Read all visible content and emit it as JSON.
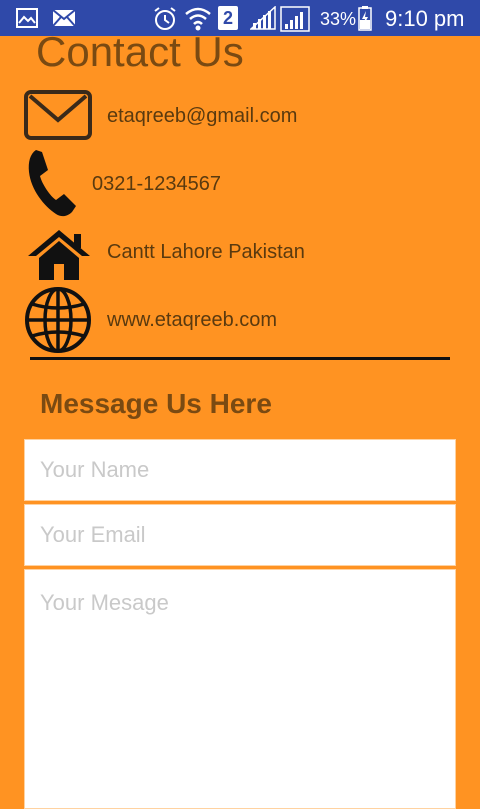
{
  "status_bar": {
    "sim_indicator": "2",
    "battery_percent": "33%",
    "time": "9:10 pm",
    "icons": [
      "gallery-icon",
      "email-icon",
      "alarm-icon",
      "wifi-icon",
      "sim-icon",
      "signal-icon",
      "signal-icon",
      "battery-icon"
    ]
  },
  "page": {
    "title": "Contact Us",
    "contacts": {
      "email": "etaqreeb@gmail.com",
      "phone": "0321-1234567",
      "address": "Cantt Lahore Pakistan",
      "website": "www.etaqreeb.com"
    },
    "message_section_title": "Message Us Here"
  },
  "form": {
    "name_placeholder": "Your Name",
    "email_placeholder": "Your Email",
    "message_placeholder": "Your Mesage"
  },
  "colors": {
    "background": "#ff9322",
    "status_bar": "#2f49a9",
    "heading": "#7a4a12"
  }
}
